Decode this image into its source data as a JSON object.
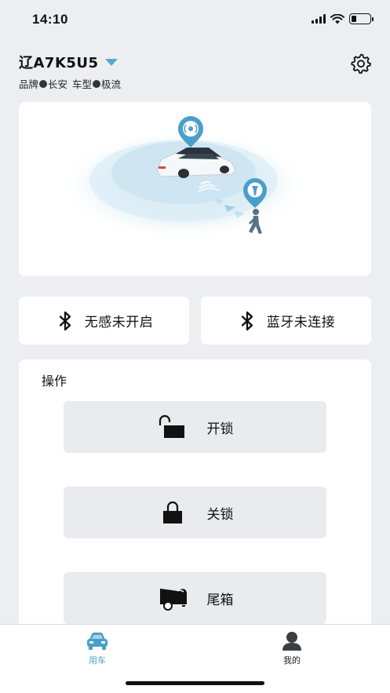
{
  "status_bar": {
    "time": "14:10",
    "battery_percent": 25
  },
  "header": {
    "plate": "辽A7K5U5",
    "brand_label": "品牌",
    "brand_value": "长安",
    "model_label": "车型",
    "model_value": "极流"
  },
  "bluetooth_cards": [
    {
      "label": "无感未开启",
      "icon": "bluetooth-icon"
    },
    {
      "label": "蓝牙未连接",
      "icon": "bluetooth-icon"
    }
  ],
  "operations": {
    "title": "操作",
    "buttons": [
      {
        "label": "开锁",
        "icon": "unlock-icon"
      },
      {
        "label": "关锁",
        "icon": "lock-icon"
      },
      {
        "label": "尾箱",
        "icon": "trunk-icon"
      }
    ]
  },
  "tabs": [
    {
      "label": "用车",
      "icon": "car-icon",
      "active": true
    },
    {
      "label": "我的",
      "icon": "user-icon",
      "active": false
    }
  ],
  "colors": {
    "accent": "#4a9fca",
    "background": "#eceef1",
    "card": "#ffffff",
    "button": "#e9ebee"
  }
}
